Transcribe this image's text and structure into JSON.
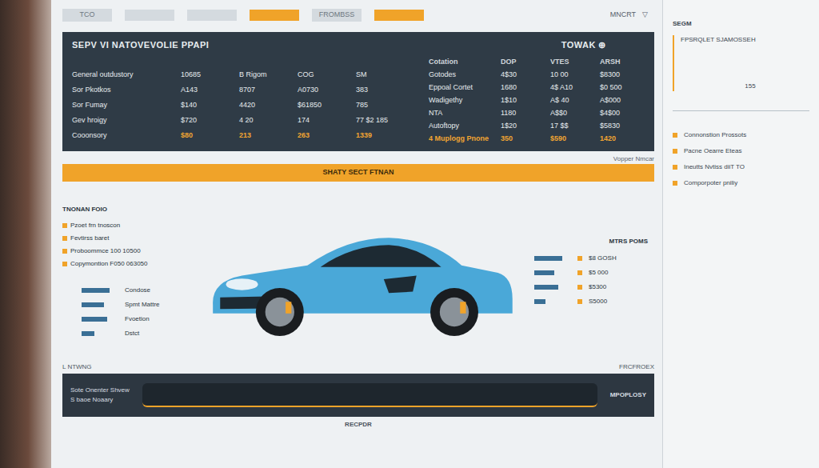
{
  "tabs": [
    {
      "label": "TCO",
      "selected": false
    },
    {
      "selected": false
    },
    {
      "selected": false
    },
    {
      "selected": true
    },
    {
      "label": "FROMBSS",
      "selected": false
    },
    {
      "selected": true
    }
  ],
  "top_right": {
    "label": "MNCRT",
    "caret": "▽"
  },
  "table": {
    "title": "SEPV VI NATOVEVOLIE PPAPI",
    "tag": "TOWAK ⊕",
    "left_rows": [
      {
        "cells": [
          "General outdustory",
          "10685",
          "B Rigom",
          "COG",
          "SM"
        ],
        "accent": false
      },
      {
        "cells": [
          "Sor Pkotkos",
          "A143",
          "8707",
          "A0730",
          "383"
        ],
        "accent": false
      },
      {
        "cells": [
          "Sor Fumay",
          "$140",
          "4420",
          "$61850",
          "785"
        ],
        "accent": false
      },
      {
        "cells": [
          "Gev hroigy",
          "$720",
          "4 20",
          "174",
          "77 $2 185"
        ],
        "accent": false
      },
      {
        "cells": [
          "Cooonsory",
          "$80",
          "213",
          "263",
          "1339"
        ],
        "accent": true
      }
    ],
    "right_columns": [
      "Cotation",
      "DOP",
      "VTES",
      "ARSH"
    ],
    "right_rows": [
      {
        "cells": [
          "Gotodes",
          "4$30",
          "10 00",
          "$8300"
        ],
        "accent": false
      },
      {
        "cells": [
          "Eppoal Cortet",
          "1680",
          "4$ A10",
          "$0 500"
        ],
        "accent": false
      },
      {
        "cells": [
          "Wadigethy",
          "1$10",
          "A$ 40",
          "A$000"
        ],
        "accent": false
      },
      {
        "cells": [
          "NTA",
          "1180",
          "A$$0",
          "$4$00"
        ],
        "accent": false
      },
      {
        "cells": [
          "Autoftopy",
          "1$20",
          "17 $$",
          "$5830"
        ],
        "accent": false
      },
      {
        "cells": [
          "4 Muplogg Pnone",
          "350",
          "$590",
          "1420"
        ],
        "accent": true
      }
    ]
  },
  "panel_note": "Vopper Nmcar",
  "banner": "SHATY SECT FTNAN",
  "legend": {
    "title": "TNONAN FOIO",
    "items": [
      "Pzoet frn tnoscon",
      "Fevtirss baret",
      "Proboommce 100 10500",
      "Copymontion F050 063050"
    ]
  },
  "left_bars": [
    {
      "label": "Condose",
      "level": 0.75
    },
    {
      "label": "Spmt Mattre",
      "level": 0.6
    },
    {
      "label": "Fvoetion",
      "level": 0.7
    },
    {
      "label": "Dstct",
      "level": 0.35
    }
  ],
  "right_bars": {
    "title": "MTRS POMS",
    "items": [
      {
        "value": "$8 GOSH",
        "level": 0.75
      },
      {
        "value": "$5 000",
        "level": 0.55
      },
      {
        "value": "$5300",
        "level": 0.65
      },
      {
        "value": "S5000",
        "level": 0.3
      }
    ]
  },
  "footer_label": "L NTWNG",
  "corner_label": "FRCFROEX",
  "bottom_bar": {
    "lines": [
      "Sote Onenter Shvew",
      "S baoe Noaary"
    ],
    "right": "MPOPLOSY",
    "tab": "RECPDR"
  },
  "sidebar": {
    "title": "SEGM",
    "subtitle": "FPSRQLET SJAMOSSEH",
    "value": "155",
    "items": [
      "Connonstion Prossots",
      "Pacne Oearre Eteas",
      "Ineutts Nvtiss diiT TO",
      "Comporpoter pniliy"
    ]
  }
}
